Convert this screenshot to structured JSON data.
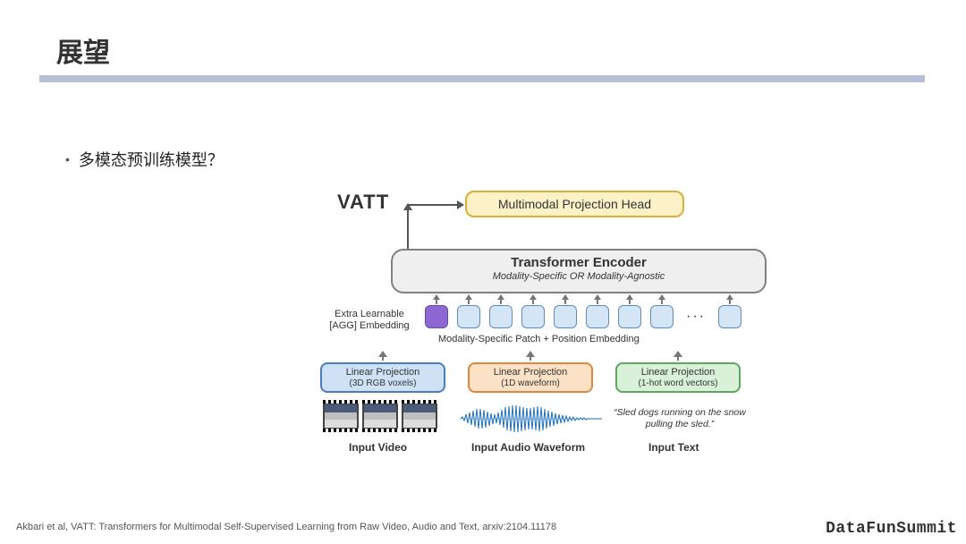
{
  "title": "展望",
  "bullet": "多模态预训练模型？",
  "brand": "DataFunSummit",
  "citation": "Akbari et al, VATT: Transformers for Multimodal Self-Supervised Learning from Raw Video, Audio and Text, arxiv:2104.11178",
  "diagram": {
    "vatt": "VATT",
    "head": "Multimodal Projection Head",
    "encoder": {
      "title": "Transformer Encoder",
      "subtitle": "Modality-Specific   OR   Modality-Agnostic"
    },
    "extra_embedding": {
      "l1": "Extra Learnable",
      "l2": "[AGG] Embedding"
    },
    "ms_label": "Modality-Specific Patch + Position Embedding",
    "projections": {
      "video": {
        "title": "Linear Projection",
        "sub": "(3D RGB voxels)"
      },
      "audio": {
        "title": "Linear Projection",
        "sub": "(1D waveform)"
      },
      "text": {
        "title": "Linear Projection",
        "sub": "(1-hot word vectors)"
      }
    },
    "sample_text": "“Sled dogs running on the snow pulling the sled.”",
    "input_labels": {
      "video": "Input Video",
      "audio": "Input Audio Waveform",
      "text": "Input Text"
    },
    "dots": "···"
  }
}
